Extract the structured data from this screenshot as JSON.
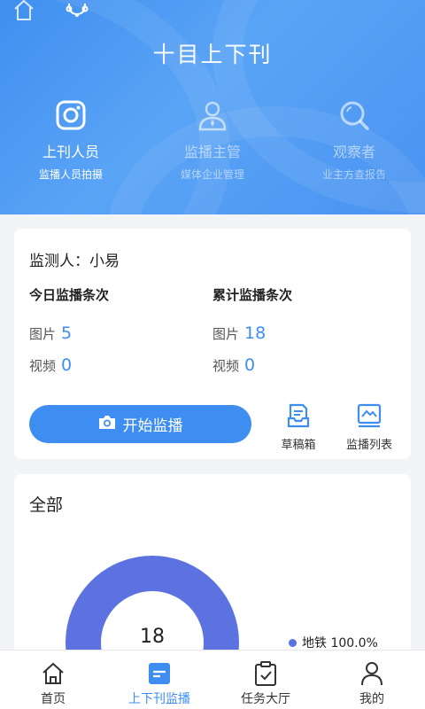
{
  "header": {
    "title": "十目上下刊",
    "roles": [
      {
        "name": "上刊人员",
        "sub": "监播人员拍摄",
        "icon": "camera-icon"
      },
      {
        "name": "监播主管",
        "sub": "媒体企业管理",
        "icon": "supervisor-icon"
      },
      {
        "name": "观察者",
        "sub": "业主方查报告",
        "icon": "magnifier-icon"
      }
    ]
  },
  "monitor": {
    "label": "监测人：小易",
    "today": {
      "title": "今日监播条次",
      "photo_label": "图片",
      "photo": "5",
      "video_label": "视频",
      "video": "0"
    },
    "total": {
      "title": "累计监播条次",
      "photo_label": "图片",
      "photo": "18",
      "video_label": "视频",
      "video": "0"
    },
    "start_button": "开始监播",
    "draft_label": "草稿箱",
    "list_label": "监播列表"
  },
  "summary": {
    "title": "全部",
    "total": "18",
    "legend": "地铁 100.0%",
    "accent": "#5b72e0"
  },
  "nav": [
    {
      "label": "首页",
      "icon": "home-icon"
    },
    {
      "label": "上下刊监播",
      "icon": "monitor-icon"
    },
    {
      "label": "任务大厅",
      "icon": "task-icon"
    },
    {
      "label": "我的",
      "icon": "user-icon"
    }
  ],
  "colors": {
    "primary": "#3d8ef0",
    "header": "#4a93f2"
  }
}
